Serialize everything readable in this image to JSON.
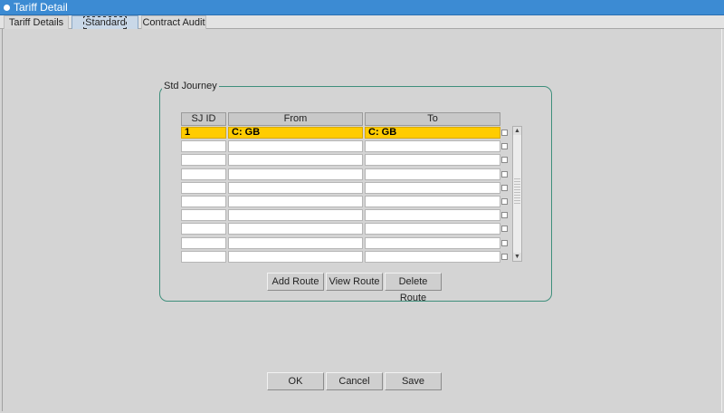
{
  "window": {
    "title": "Tariff Detail"
  },
  "tabs": [
    {
      "label": "Tariff Details",
      "active": false
    },
    {
      "label": "Standard Journey",
      "active": true
    },
    {
      "label": "Contract Audit",
      "active": false
    }
  ],
  "group": {
    "legend": "Std Journey"
  },
  "table": {
    "columns": [
      "SJ ID",
      "From",
      "To"
    ],
    "rows": [
      {
        "sj_id": "1",
        "from": "C: GB",
        "to": "C: GB",
        "selected": true
      },
      {
        "sj_id": "",
        "from": "",
        "to": ""
      },
      {
        "sj_id": "",
        "from": "",
        "to": ""
      },
      {
        "sj_id": "",
        "from": "",
        "to": ""
      },
      {
        "sj_id": "",
        "from": "",
        "to": ""
      },
      {
        "sj_id": "",
        "from": "",
        "to": ""
      },
      {
        "sj_id": "",
        "from": "",
        "to": ""
      },
      {
        "sj_id": "",
        "from": "",
        "to": ""
      },
      {
        "sj_id": "",
        "from": "",
        "to": ""
      },
      {
        "sj_id": "",
        "from": "",
        "to": ""
      }
    ]
  },
  "route_buttons": {
    "add": "Add Route",
    "view": "View Route",
    "delete": "Delete Route"
  },
  "footer_buttons": {
    "ok": "OK",
    "cancel": "Cancel",
    "save": "Save"
  },
  "colors": {
    "title_bar": "#3c8bd3",
    "selected_row": "#ffcc00",
    "group_border": "#3f8f7c"
  },
  "icons": {
    "title": "window-icon",
    "scroll_up": "scroll-up-arrow-icon",
    "scroll_down": "scroll-down-arrow-icon"
  }
}
